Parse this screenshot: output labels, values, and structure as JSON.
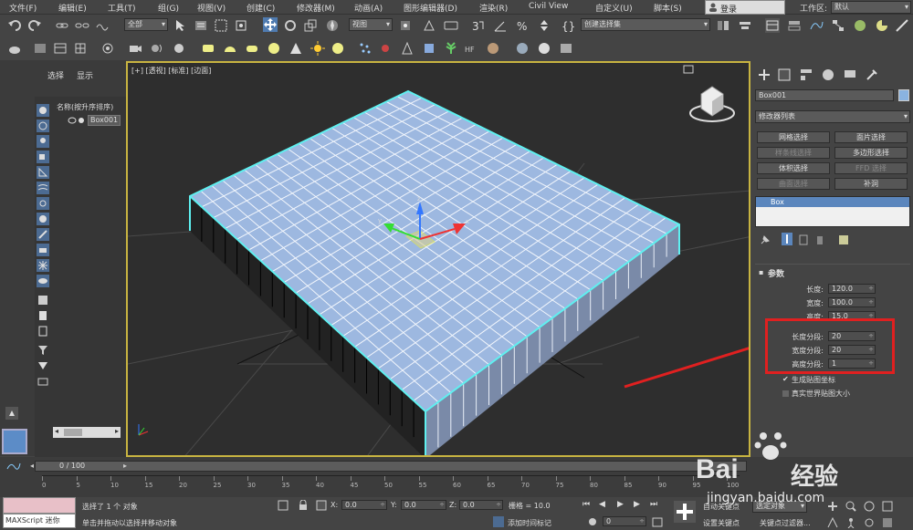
{
  "menubar": {
    "items": [
      "文件(F)",
      "编辑(E)",
      "工具(T)",
      "组(G)",
      "视图(V)",
      "创建(C)",
      "修改器(M)",
      "动画(A)",
      "图形编辑器(D)",
      "渲染(R)",
      "Civil View",
      "自定义(U)",
      "脚本(S)"
    ],
    "login": "登录",
    "workspace_label": "工作区:",
    "workspace_value": "默认"
  },
  "toolbar": {
    "filter": "全部",
    "refsys": "视图",
    "selset": "创建选择集"
  },
  "scene_explorer": {
    "tab_select": "选择",
    "tab_display": "显示",
    "header": "名称(按升序排序)",
    "item": "Box001"
  },
  "viewport": {
    "labels": [
      "[+]",
      "[透视]",
      "[标准]",
      "[边面]"
    ]
  },
  "command_panel": {
    "object_name": "Box001",
    "modifier_list": "修改器列表",
    "buttons": [
      {
        "label": "网格选择",
        "enabled": true
      },
      {
        "label": "面片选择",
        "enabled": true
      },
      {
        "label": "样条线选择",
        "enabled": false
      },
      {
        "label": "多边形选择",
        "enabled": true
      },
      {
        "label": "体积选择",
        "enabled": true
      },
      {
        "label": "FFD 选择",
        "enabled": false
      },
      {
        "label": "曲面选择",
        "enabled": false
      },
      {
        "label": "补洞",
        "enabled": true
      }
    ],
    "stack_item": "Box",
    "rollout": "参数",
    "params": [
      {
        "label": "长度:",
        "value": "120.0"
      },
      {
        "label": "宽度:",
        "value": "100.0"
      },
      {
        "label": "高度:",
        "value": "15.0"
      },
      {
        "label": "长度分段:",
        "value": "20"
      },
      {
        "label": "宽度分段:",
        "value": "20"
      },
      {
        "label": "高度分段:",
        "value": "1"
      }
    ],
    "check_mapping": "生成贴图坐标",
    "check_realworld": "真实世界贴图大小"
  },
  "timeline": {
    "frame": "0 / 100",
    "ticks": [
      "0",
      "5",
      "10",
      "15",
      "20",
      "25",
      "30",
      "35",
      "40",
      "45",
      "50",
      "55",
      "60",
      "65",
      "70",
      "75",
      "80",
      "85",
      "90",
      "95",
      "100"
    ]
  },
  "status": {
    "maxscript": "MAXScript 迷你",
    "selected": "选择了 1 个 对象",
    "hint": "单击并拖动以选择并移动对象",
    "x_label": "X:",
    "x": "0.0",
    "y_label": "Y:",
    "y": "0.0",
    "z_label": "Z:",
    "z": "0.0",
    "grid": "栅格 = 10.0",
    "add_tag": "添加时间标记",
    "auto_key": "自动关键点",
    "sel_obj": "选定对象",
    "set_key": "设置关键点",
    "key_filter": "关键点过滤器...",
    "frame_field": "0"
  },
  "watermark": {
    "brand": "Bai",
    "brand2": "经验",
    "url": "jingyan.baidu.com"
  }
}
